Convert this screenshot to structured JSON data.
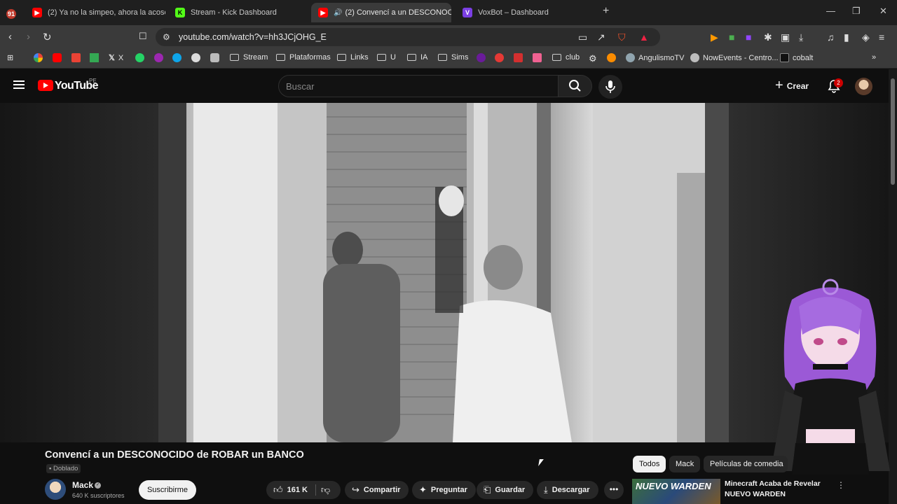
{
  "browser": {
    "tabs": [
      {
        "title": "(2) Ya no la simpeo, ahora la acoso. C",
        "favicon": "youtube",
        "color": "#ff0000"
      },
      {
        "title": "Stream - Kick Dashboard",
        "favicon": "kick",
        "color": "#53fc18"
      },
      {
        "title": "(2) Convencí a un DESCONOC",
        "favicon": "youtube",
        "color": "#ff0000",
        "active": true
      },
      {
        "title": "VoxBot – Dashboard",
        "favicon": "voxbot",
        "color": "#7b3fe4"
      }
    ],
    "url": "youtube.com/watch?v=hh3JCjOHG_E",
    "bookmarks": [
      "X",
      "Stream",
      "Plataformas",
      "Links",
      "U",
      "IA",
      "Sims",
      "club",
      "AngulismoTV",
      "NowEvents - Centro...",
      "cobalt"
    ]
  },
  "youtube": {
    "region": "PE",
    "wordmark": "YouTube",
    "search_placeholder": "Buscar",
    "create_label": "Crear",
    "notification_count": "2"
  },
  "video": {
    "title": "Convencí a un DESCONOCIDO de ROBAR un BANCO",
    "dub_label": "Doblado",
    "channel_name": "Mack",
    "channel_subs": "640 K suscriptores",
    "subscribe_label": "Suscribirme",
    "likes": "161 K",
    "share_label": "Compartir",
    "ask_label": "Preguntar",
    "save_label": "Guardar",
    "download_label": "Descargar"
  },
  "sidebar": {
    "chips": [
      "Todos",
      "Mack",
      "Películas de comedia"
    ],
    "recommendation": {
      "thumb_text": "NUEVO WARDEN",
      "title": "Minecraft Acaba de Revelar NUEVO WARDEN"
    }
  },
  "colors": {
    "accent": "#ff0000",
    "background": "#0f0f0f",
    "badge": "#cc0000"
  }
}
